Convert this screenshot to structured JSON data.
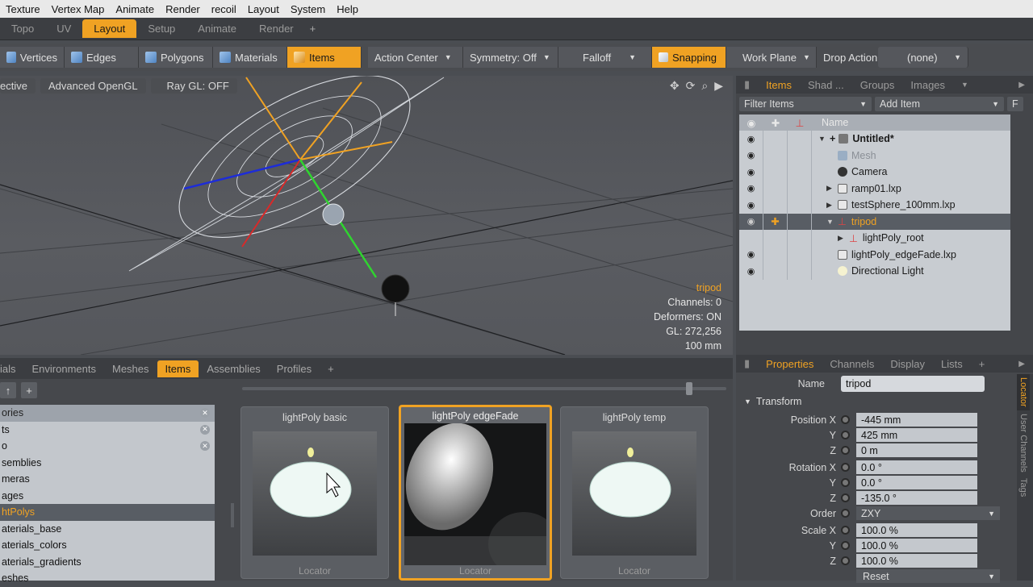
{
  "menu": [
    "Texture",
    "Vertex Map",
    "Animate",
    "Render",
    "recoil",
    "Layout",
    "System",
    "Help"
  ],
  "layout_tabs": [
    "Topo",
    "UV",
    "Layout",
    "Setup",
    "Animate",
    "Render"
  ],
  "layout_tabs_active": "Layout",
  "toolbar": {
    "vertices": "Vertices",
    "edges": "Edges",
    "polygons": "Polygons",
    "materials": "Materials",
    "items": "Items",
    "action_center": "Action Center",
    "symmetry": "Symmetry: Off",
    "falloff": "Falloff",
    "snapping": "Snapping",
    "work_plane": "Work Plane",
    "drop_action": "Drop Action",
    "drop_value": "(none)"
  },
  "viewport": {
    "projection": "ective",
    "render_mode": "Advanced OpenGL",
    "ray_gl": "Ray GL: OFF",
    "info": {
      "selected": "tripod",
      "channels": "Channels: 0",
      "deformers": "Deformers: ON",
      "gl": "GL: 272,256",
      "scale": "100 mm"
    }
  },
  "items_panel": {
    "tabs": [
      "Items",
      "Shad ...",
      "Groups",
      "Images"
    ],
    "active": "Items",
    "filter": "Filter Items",
    "add": "Add Item",
    "f": "F",
    "col_name": "Name",
    "rows": [
      "Untitled*",
      "Mesh",
      "Camera",
      "ramp01.lxp",
      "testSphere_100mm.lxp",
      "tripod",
      "lightPoly_root",
      "lightPoly_edgeFade.lxp",
      "Directional Light"
    ]
  },
  "bottom": {
    "tabs": [
      "ials",
      "Environments",
      "Meshes",
      "Items",
      "Assemblies",
      "Profiles"
    ],
    "active": "Items",
    "categories": [
      "ories",
      "ts",
      "o",
      "semblies",
      "meras",
      "ages",
      "htPolys",
      "aterials_base",
      "aterials_colors",
      "aterials_gradients",
      "eshes"
    ],
    "presets": [
      {
        "title": "lightPoly basic",
        "foot": "Locator"
      },
      {
        "title": "lightPoly edgeFade",
        "foot": "Locator"
      },
      {
        "title": "lightPoly temp",
        "foot": "Locator"
      }
    ]
  },
  "properties": {
    "tabs": [
      "Properties",
      "Channels",
      "Display",
      "Lists"
    ],
    "active": "Properties",
    "name_label": "Name",
    "name": "tripod",
    "section": "Transform",
    "pos_x_label": "Position X",
    "pos_x": "-445 mm",
    "y_label": "Y",
    "pos_y": "425 mm",
    "z_label": "Z",
    "pos_z": "0 m",
    "rot_x_label": "Rotation X",
    "rot_x": "0.0 °",
    "rot_y": "0.0 °",
    "rot_z": "-135.0 °",
    "order_label": "Order",
    "order": "ZXY",
    "scale_x_label": "Scale X",
    "scale_x": "100.0 %",
    "scale_y": "100.0 %",
    "scale_z": "100.0 %",
    "reset": "Reset",
    "side_tabs": [
      "Locator",
      "User Channels",
      "Tags"
    ]
  }
}
